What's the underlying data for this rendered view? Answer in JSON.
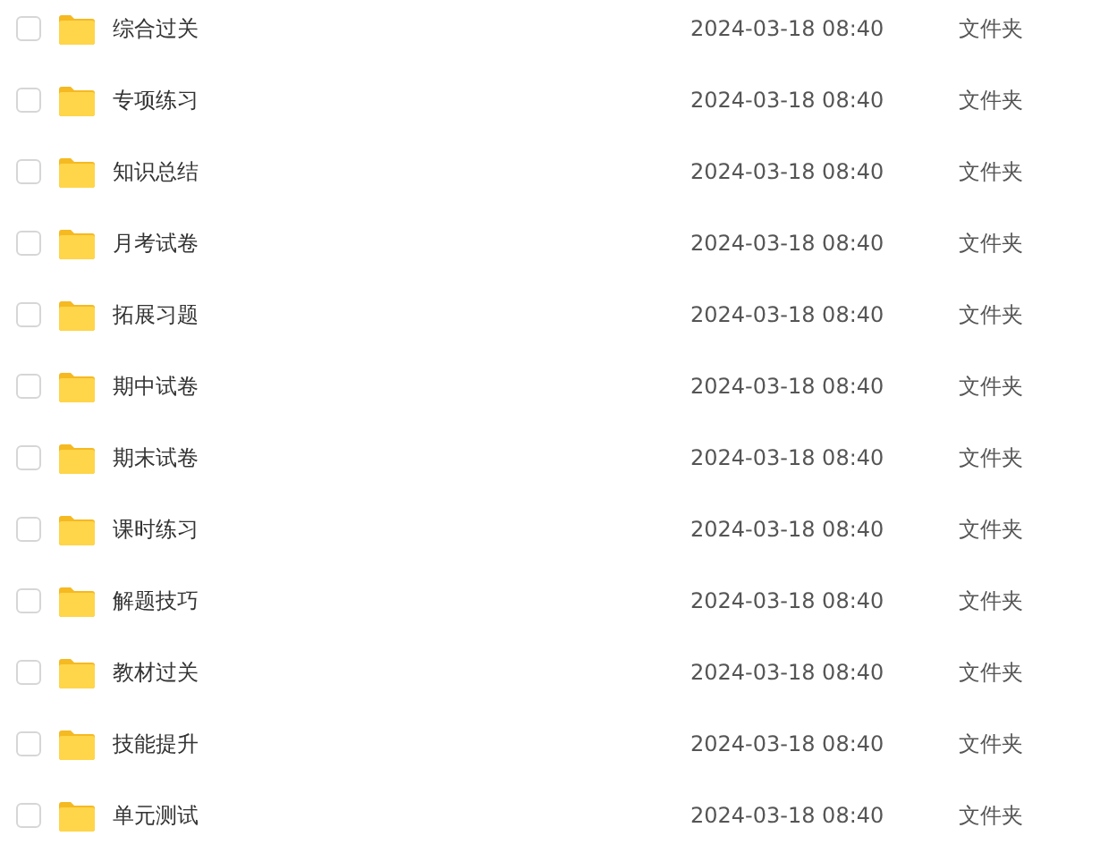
{
  "files": [
    {
      "name": "综合过关",
      "modified": "2024-03-18 08:40",
      "type": "文件夹",
      "checked": false
    },
    {
      "name": "专项练习",
      "modified": "2024-03-18 08:40",
      "type": "文件夹",
      "checked": false
    },
    {
      "name": "知识总结",
      "modified": "2024-03-18 08:40",
      "type": "文件夹",
      "checked": false
    },
    {
      "name": "月考试卷",
      "modified": "2024-03-18 08:40",
      "type": "文件夹",
      "checked": false
    },
    {
      "name": "拓展习题",
      "modified": "2024-03-18 08:40",
      "type": "文件夹",
      "checked": false
    },
    {
      "name": "期中试卷",
      "modified": "2024-03-18 08:40",
      "type": "文件夹",
      "checked": false
    },
    {
      "name": "期末试卷",
      "modified": "2024-03-18 08:40",
      "type": "文件夹",
      "checked": false
    },
    {
      "name": "课时练习",
      "modified": "2024-03-18 08:40",
      "type": "文件夹",
      "checked": false
    },
    {
      "name": "解题技巧",
      "modified": "2024-03-18 08:40",
      "type": "文件夹",
      "checked": false
    },
    {
      "name": "教材过关",
      "modified": "2024-03-18 08:40",
      "type": "文件夹",
      "checked": false
    },
    {
      "name": "技能提升",
      "modified": "2024-03-18 08:40",
      "type": "文件夹",
      "checked": false
    },
    {
      "name": "单元测试",
      "modified": "2024-03-18 08:40",
      "type": "文件夹",
      "checked": false
    }
  ]
}
